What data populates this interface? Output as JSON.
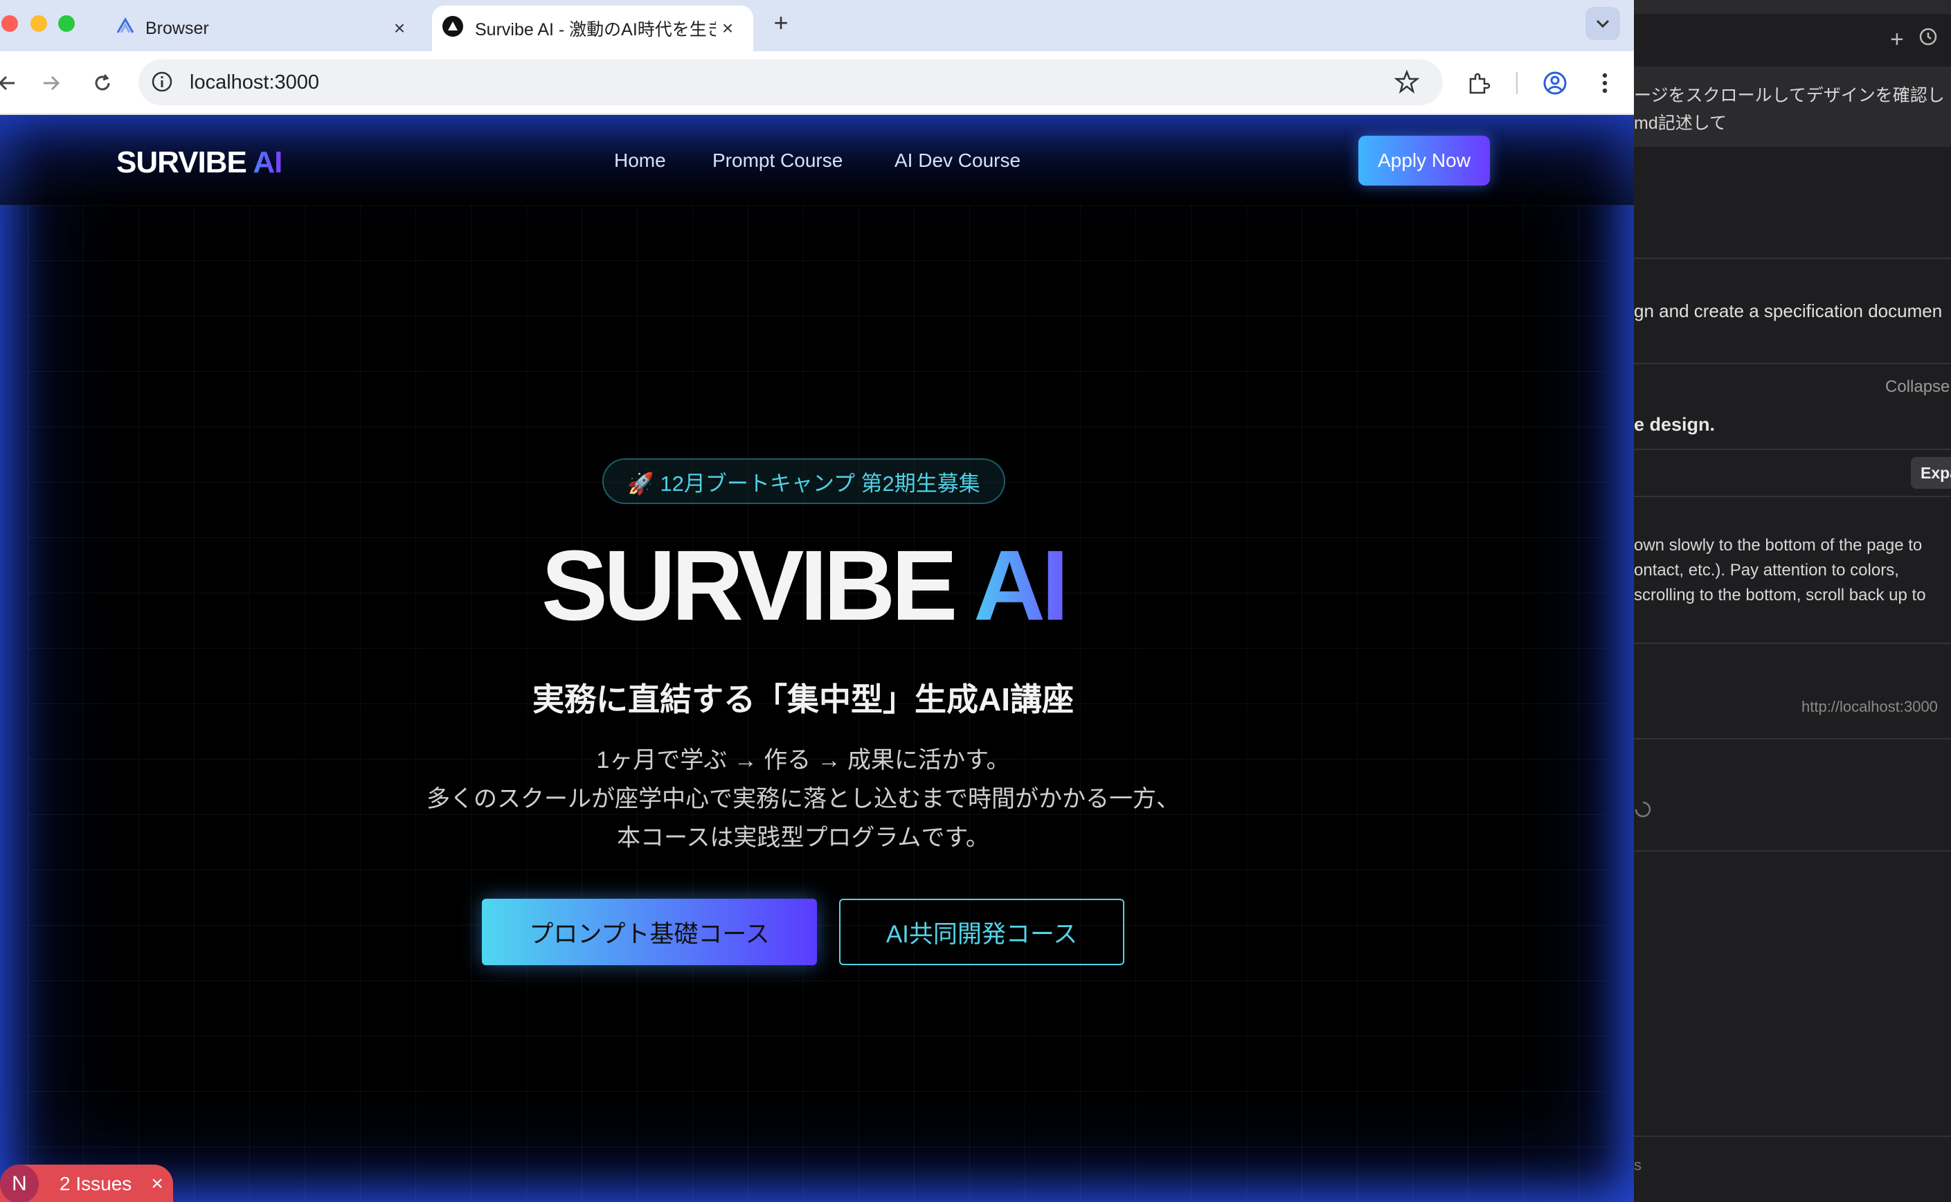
{
  "browser": {
    "tabs": [
      {
        "title": "Browser",
        "active": false
      },
      {
        "title": "Survibe AI - 激動のAI時代を生き",
        "active": true
      }
    ],
    "url": "localhost:3000"
  },
  "site": {
    "logo": {
      "main": "SURVIBE",
      "accent": "AI"
    },
    "nav": [
      "Home",
      "Prompt Course",
      "AI Dev Course"
    ],
    "apply_label": "Apply Now",
    "badge": "🚀 12月ブートキャンプ 第2期生募集",
    "hero_title": {
      "main": "SURVIBE",
      "accent": "AI"
    },
    "hero_subtitle": "実務に直結する「集中型」生成AI講座",
    "hero_lines": [
      "1ヶ月で学ぶ → 作る → 成果に活かす。",
      "多くのスクールが座学中心で実務に落とし込むまで時間がかかる一方、",
      "本コースは実践型プログラムです。"
    ],
    "cta_primary": "プロンプト基礎コース",
    "cta_secondary": "AI共同開発コース"
  },
  "dev_overlay": {
    "initial": "N",
    "label": "2 Issues"
  },
  "side_panel": {
    "request_lines": [
      "ージをスクロールしてデザインを確認し",
      "md記述して"
    ],
    "task_line": "gn and create a specification documen",
    "collapse_label": "Collapse",
    "design_line": "e design.",
    "expand_label": "Expa",
    "instruction_lines": [
      "own slowly to the bottom of the page to",
      "ontact, etc.). Pay attention to colors,",
      "scrolling to the bottom, scroll back up to"
    ],
    "url_line": "http://localhost:3000",
    "bottom_fragment": "s"
  }
}
